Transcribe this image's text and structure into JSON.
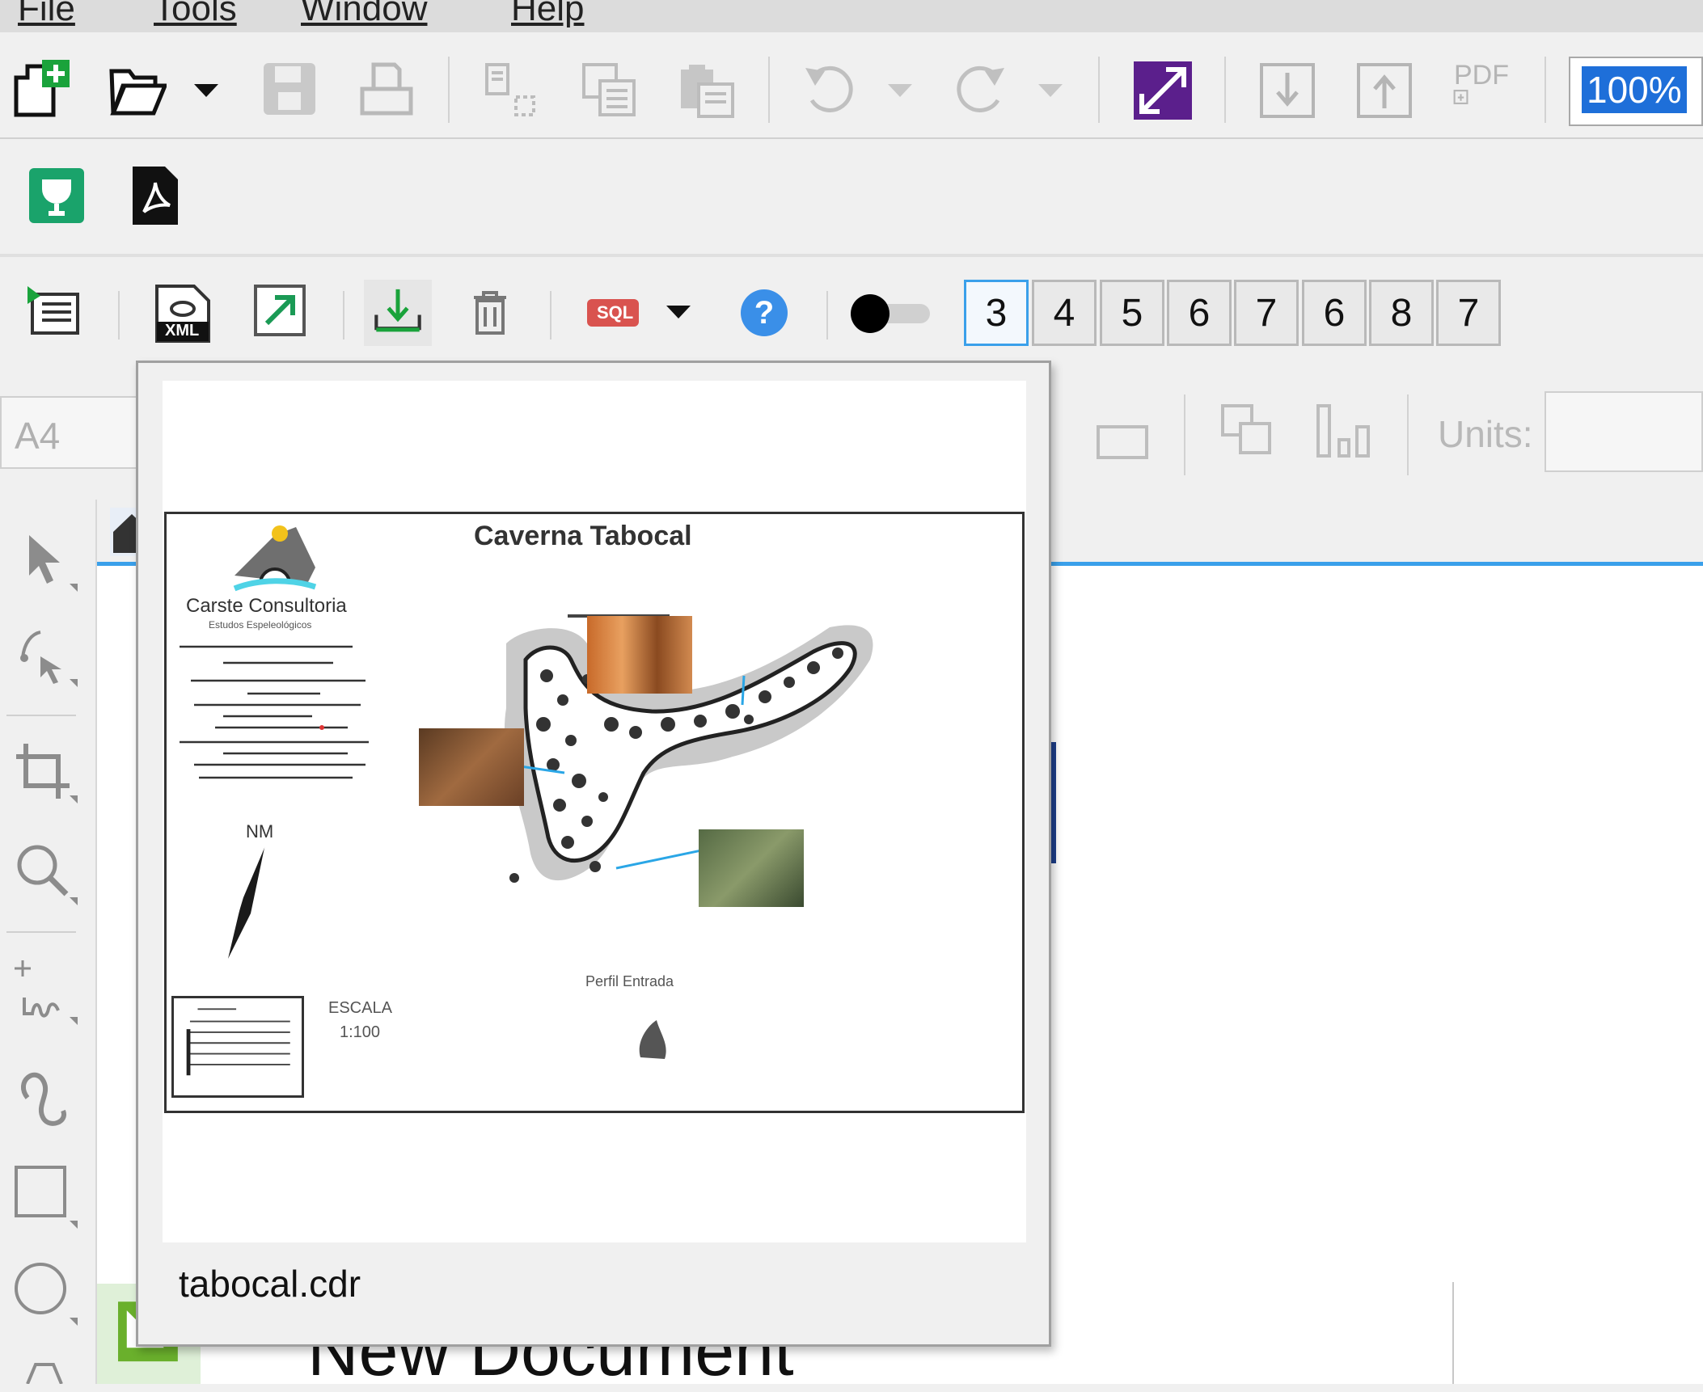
{
  "menu": [
    "File",
    "Tools",
    "Window",
    "Help"
  ],
  "toolbar": {
    "zoom": "100%",
    "pdf_label": "PDF"
  },
  "addon_toolbar": {
    "xml_label": "XML",
    "sql_label": "SQL",
    "help_glyph": "?",
    "page_buttons": [
      "3",
      "4",
      "5",
      "6",
      "7",
      "6",
      "8",
      "7"
    ],
    "active_page_index": 0
  },
  "property_bar": {
    "page_size": "A4",
    "units_label": "Units:"
  },
  "background": {
    "new_document": "New Document"
  },
  "preview": {
    "filename": "tabocal.cdr",
    "map_title": "Caverna Tabocal",
    "company": "Carste Consultoria",
    "company_sub": "Estudos Espeleológicos",
    "north": "NM",
    "scale_label": "ESCALA",
    "scale_value": "1:100",
    "profile_label": "Perfil Entrada"
  },
  "colors": {
    "accent": "#3aa0ea",
    "zoom_highlight": "#1e6fd9",
    "corel_purple": "#5b1f8c",
    "green_icon": "#1aa36b"
  }
}
